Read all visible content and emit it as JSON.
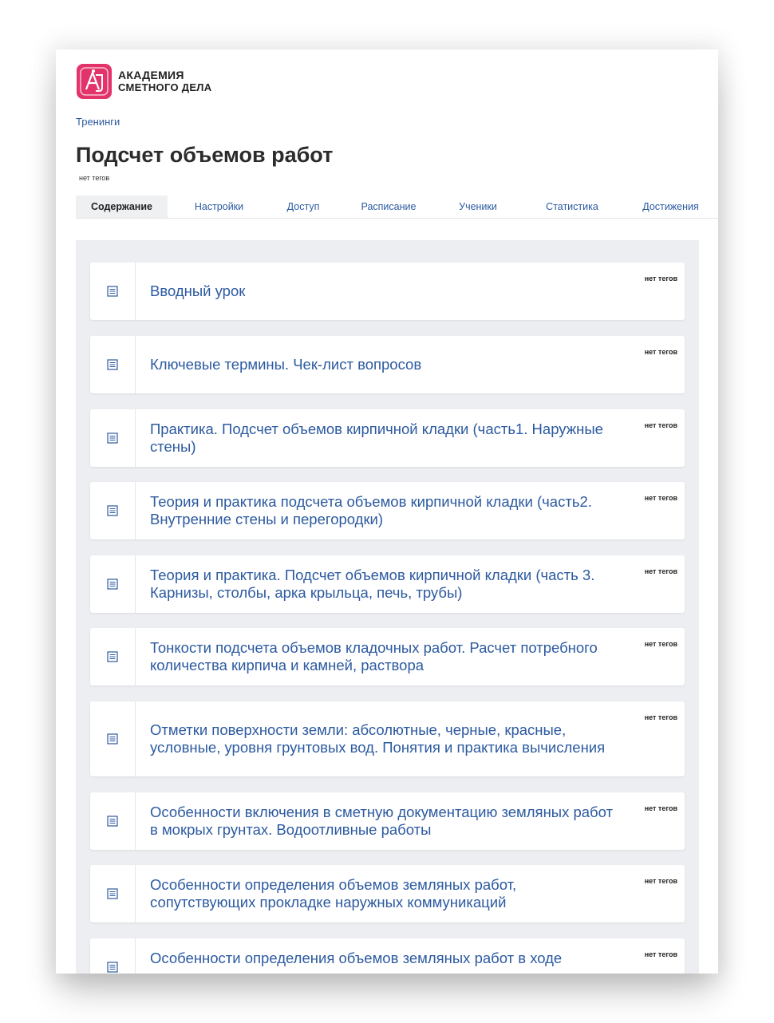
{
  "logo": {
    "line1": "АКАДЕМИЯ",
    "line2": "СМЕТНОГО ДЕЛА"
  },
  "breadcrumb": "Тренинги",
  "page_title": "Подсчет объемов работ",
  "page_tags": "нет тегов",
  "tabs": [
    {
      "label": "Содержание",
      "active": true
    },
    {
      "label": "Настройки"
    },
    {
      "label": "Доступ"
    },
    {
      "label": "Расписание"
    },
    {
      "label": "Ученики"
    },
    {
      "label": "Статистика"
    },
    {
      "label": "Достижения"
    }
  ],
  "lessons": [
    {
      "title": "Вводный урок",
      "tags": "нет тегов",
      "icon": "lesson-document-icon"
    },
    {
      "title": "Ключевые термины. Чек-лист вопросов",
      "tags": "нет тегов",
      "icon": "lesson-document-icon"
    },
    {
      "title": "Практика. Подсчет объемов кирпичной кладки (часть1. Наружные стены)",
      "tags": "нет тегов",
      "icon": "lesson-document-icon"
    },
    {
      "title": "Теория и практика подсчета объемов кирпичной кладки (часть2. Внутренние стены и перегородки)",
      "tags": "нет тегов",
      "icon": "lesson-document-icon"
    },
    {
      "title": "Теория и практика. Подсчет объемов кирпичной кладки (часть 3. Карнизы, столбы, арка крыльца, печь, трубы)",
      "tags": "нет тегов",
      "icon": "lesson-document-icon"
    },
    {
      "title": "Тонкости подсчета объемов кладочных работ. Расчет потребного количества кирпича и камней, раствора",
      "tags": "нет тегов",
      "icon": "lesson-document-icon"
    },
    {
      "title": "Отметки поверхности земли: абсолютные, черные, красные, условные, уровня грунтовых вод. Понятия и практика вычисления",
      "tags": "нет тегов",
      "icon": "lesson-document-icon"
    },
    {
      "title": "Особенности включения в сметную документацию земляных работ в мокрых грунтах. Водоотливные работы",
      "tags": "нет тегов",
      "icon": "lesson-document-icon"
    },
    {
      "title": "Особенности определения объемов земляных работ, сопутствующих прокладке наружных коммуникаций",
      "tags": "нет тегов",
      "icon": "lesson-document-icon"
    },
    {
      "title": "Особенности определения объемов земляных работ в ходе",
      "tags": "нет тегов",
      "icon": "lesson-document-icon"
    }
  ],
  "colors": {
    "accent": "#2c5aa0",
    "brand": "#e2336b",
    "content_bg": "#eceef1"
  }
}
